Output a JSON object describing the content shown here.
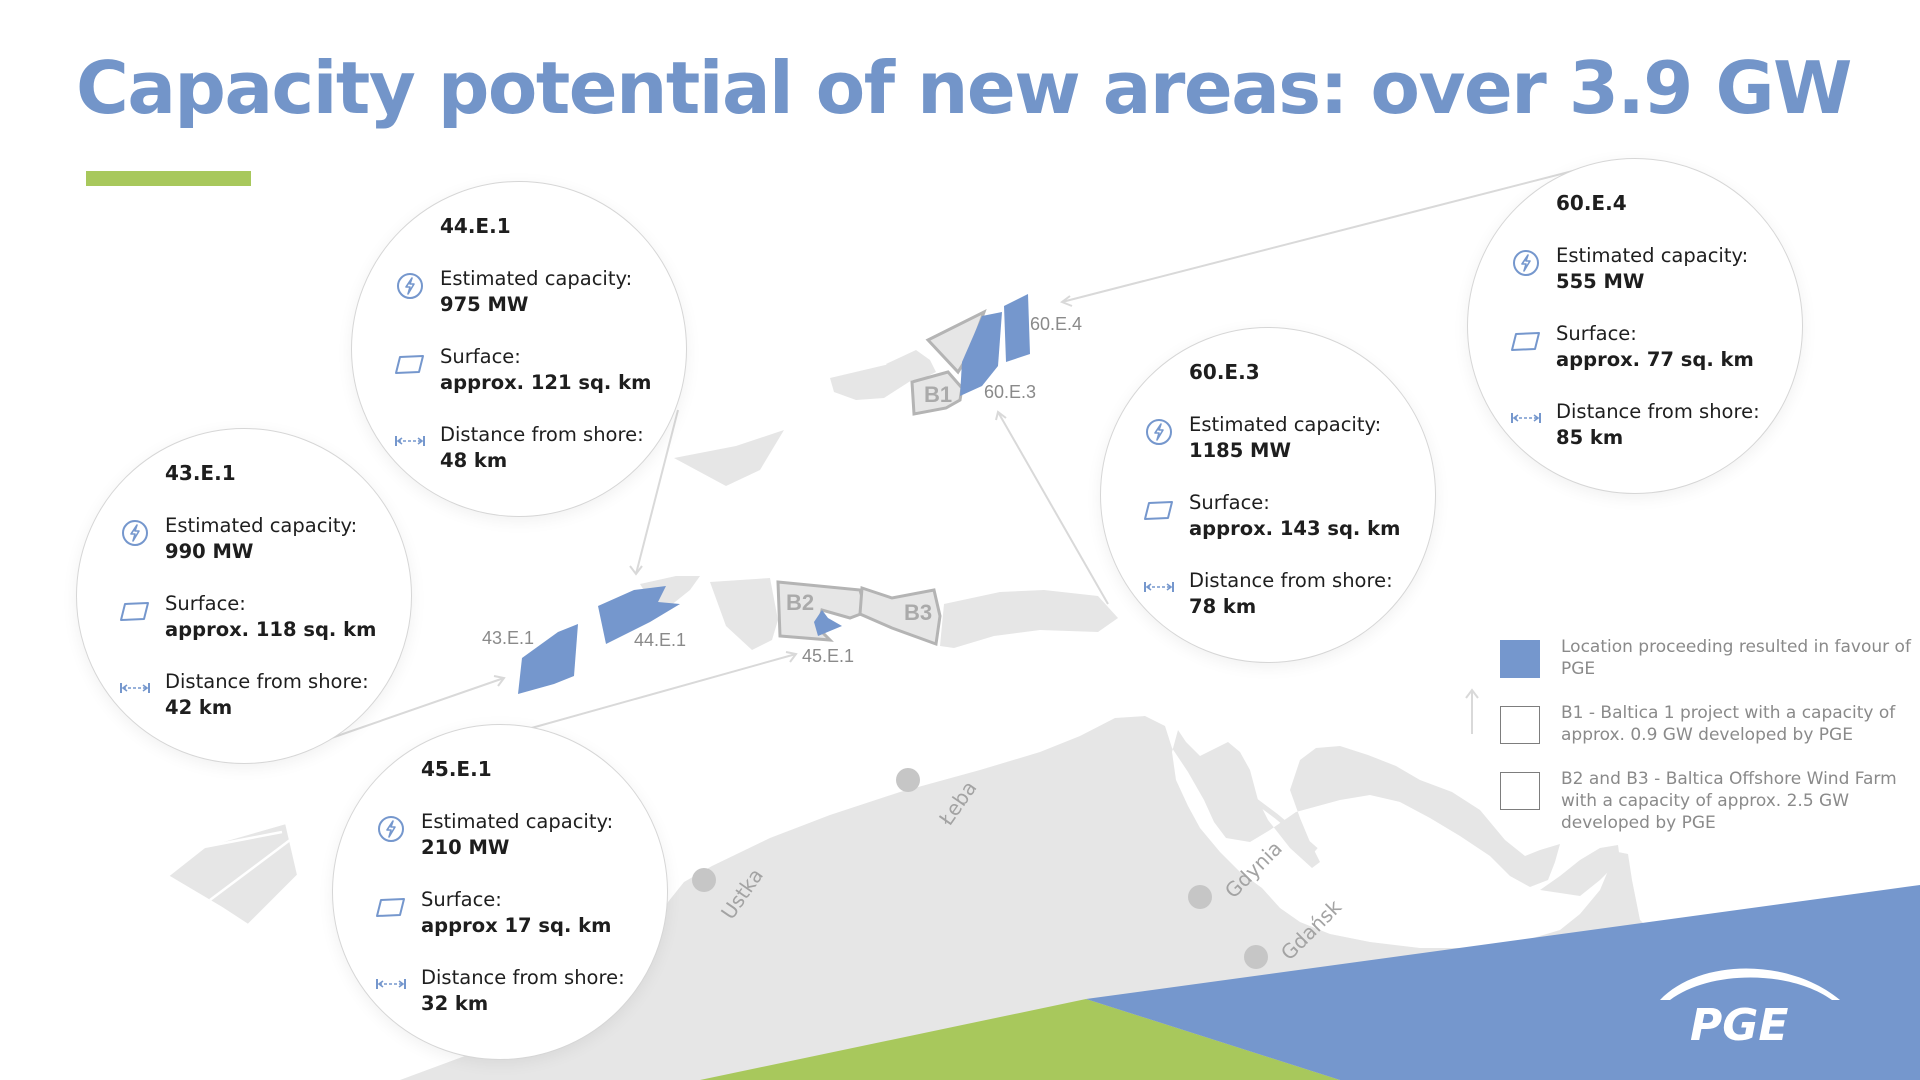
{
  "title": "Capacity potential of new areas: over 3.9 GW",
  "colors": {
    "title": "#7395c9",
    "accent_green": "#a8c85c",
    "pge_area": "#7597cd",
    "land": "#e6e6e6",
    "footer_blue": "#7597cd",
    "footer_green": "#a8c85c"
  },
  "labels": {
    "estimated_capacity": "Estimated capacity:",
    "surface": "Surface:",
    "distance": "Distance from shore:"
  },
  "areas": [
    {
      "name": "44.E.1",
      "capacity": "975 MW",
      "surface": "approx. 121 sq. km",
      "distance": "48 km"
    },
    {
      "name": "43.E.1",
      "capacity": "990 MW",
      "surface": "approx. 118 sq. km",
      "distance": "42 km"
    },
    {
      "name": "45.E.1",
      "capacity": "210 MW",
      "surface": "approx 17 sq. km",
      "distance": "32 km"
    },
    {
      "name": "60.E.3",
      "capacity": "1185 MW",
      "surface": "approx. 143 sq. km",
      "distance": "78 km"
    },
    {
      "name": "60.E.4",
      "capacity": "555 MW",
      "surface": "approx. 77 sq. km",
      "distance": "85 km"
    }
  ],
  "map_labels": {
    "area_60e4": "60.E.4",
    "area_60e3": "60.E.3",
    "area_43e1": "43.E.1",
    "area_44e1": "44.E.1",
    "area_45e1": "45.E.1",
    "b1": "B1",
    "b2": "B2",
    "b3": "B3"
  },
  "cities": {
    "ustka": "Ustka",
    "leba": "Łeba",
    "gdynia": "Gdynia",
    "gdansk": "Gdańsk"
  },
  "legend": [
    {
      "text": "Location proceeding resulted in favour of PGE",
      "filled": true
    },
    {
      "text": "B1 - Baltica 1 project with a capacity of approx. 0.9 GW developed by PGE",
      "filled": false
    },
    {
      "text": "B2 and B3 - Baltica Offshore Wind Farm with a capacity of approx. 2.5 GW developed by PGE",
      "filled": false
    }
  ],
  "logo": {
    "text": "PGE",
    "icon": "pge-arc-logo-icon"
  },
  "icons": {
    "capacity": "lightning-icon",
    "surface": "parallelogram-icon",
    "distance": "distance-arrows-icon"
  }
}
